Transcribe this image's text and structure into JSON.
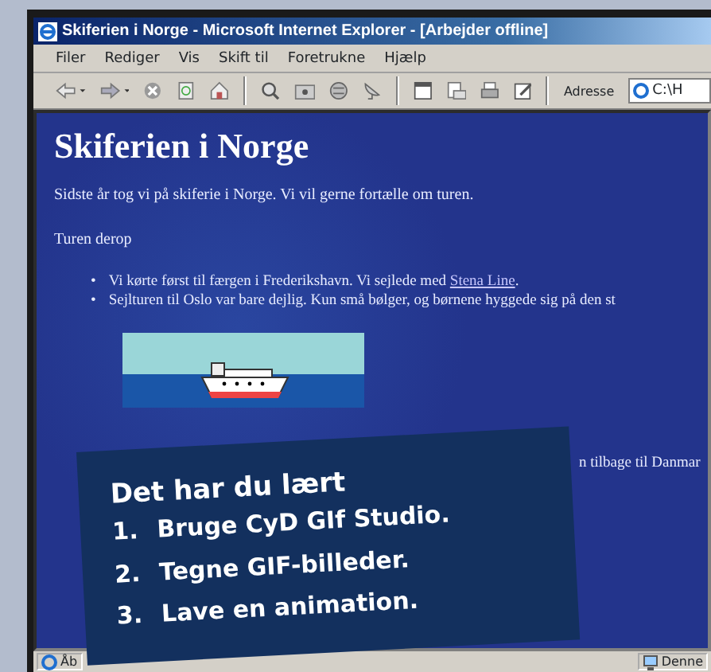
{
  "window": {
    "title": "Skiferien i Norge - Microsoft Internet Explorer - [Arbejder offline]"
  },
  "menu": [
    "Filer",
    "Rediger",
    "Vis",
    "Skift til",
    "Foretrukne",
    "Hjælp"
  ],
  "address": {
    "label": "Adresse",
    "value": "C:\\H"
  },
  "page": {
    "heading": "Skiferien i Norge",
    "intro": "Sidste år tog vi på skiferie i Norge. Vi vil gerne fortælle om turen.",
    "subheading": "Turen derop",
    "bullets": [
      {
        "marker": "•",
        "before": "Vi kørte først til færgen i Frederikshavn. Vi sejlede med ",
        "link": "Stena Line",
        "after": "."
      },
      {
        "marker": "•",
        "before": "Sejlturen til Oslo var bare dejlig. Kun små bølger, og børnene hyggede sig på den st"
      }
    ],
    "fragment": "n tilbage til Danmar"
  },
  "status_bar": {
    "left": "Åb",
    "right": "Denne"
  },
  "summary": {
    "title": "Det har du lært",
    "items": [
      {
        "number": "1.",
        "text": "Bruge CyD GIf Studio."
      },
      {
        "number": "2.",
        "text": "Tegne GIF-billeder."
      },
      {
        "number": "3.",
        "text": "Lave en animation."
      }
    ]
  }
}
